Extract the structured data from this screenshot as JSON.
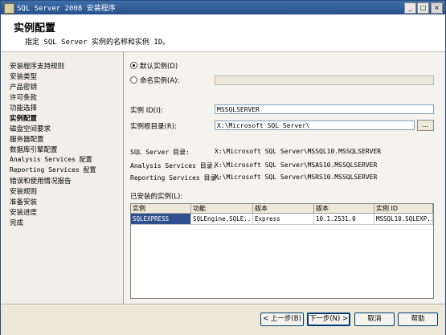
{
  "window": {
    "title": "SQL Server 2008 安装程序",
    "min_glyph": "_",
    "max_glyph": "□",
    "close_glyph": "×"
  },
  "header": {
    "title": "实例配置",
    "description": "指定 SQL Server 实例的名称和实例 ID。"
  },
  "sidebar": {
    "items": [
      {
        "label": "安装程序支持规则"
      },
      {
        "label": "安装类型"
      },
      {
        "label": "产品密钥"
      },
      {
        "label": "许可条款"
      },
      {
        "label": "功能选择"
      },
      {
        "label": "实例配置"
      },
      {
        "label": "磁盘空间要求"
      },
      {
        "label": "服务器配置"
      },
      {
        "label": "数据库引擎配置"
      },
      {
        "label": "Analysis Services 配置"
      },
      {
        "label": "Reporting Services 配置"
      },
      {
        "label": "错误和使用情况报告"
      },
      {
        "label": "安装规则"
      },
      {
        "label": "准备安装"
      },
      {
        "label": "安装进度"
      },
      {
        "label": "完成"
      }
    ],
    "active_index": 5
  },
  "main": {
    "default_instance_label": "默认实例(D)",
    "named_instance_label": "命名实例(A):",
    "named_instance_value": "",
    "instance_id_label": "实例 ID(I):",
    "instance_id_value": "MSSQLSERVER",
    "instance_root_label": "实例根目录(R):",
    "instance_root_value": "X:\\Microsoft SQL Server\\",
    "browse_label": "...",
    "dirs": {
      "sql_label": "SQL Server 目录:",
      "sql_value": "X:\\Microsoft SQL Server\\MSSQL10.MSSQLSERVER",
      "as_label": "Analysis Services 目录:",
      "as_value": "X:\\Microsoft SQL Server\\MSAS10.MSSQLSERVER",
      "rs_label": "Reporting Services 目录:",
      "rs_value": "X:\\Microsoft SQL Server\\MSRS10.MSSQLSERVER"
    },
    "installed_label": "已安装的实例(L):",
    "table": {
      "headers": [
        "实例",
        "功能",
        "版本",
        "版本",
        "实例 ID"
      ],
      "rows": [
        [
          "SQLEXPRESS",
          "SQLEngine,SQLE...",
          "Express",
          "10.1.2531.0",
          "MSSQL10.SQLEXP..."
        ]
      ]
    }
  },
  "footer": {
    "back": "< 上一步(B)",
    "next": "下一步(N) >",
    "cancel": "取消",
    "help": "帮助"
  }
}
